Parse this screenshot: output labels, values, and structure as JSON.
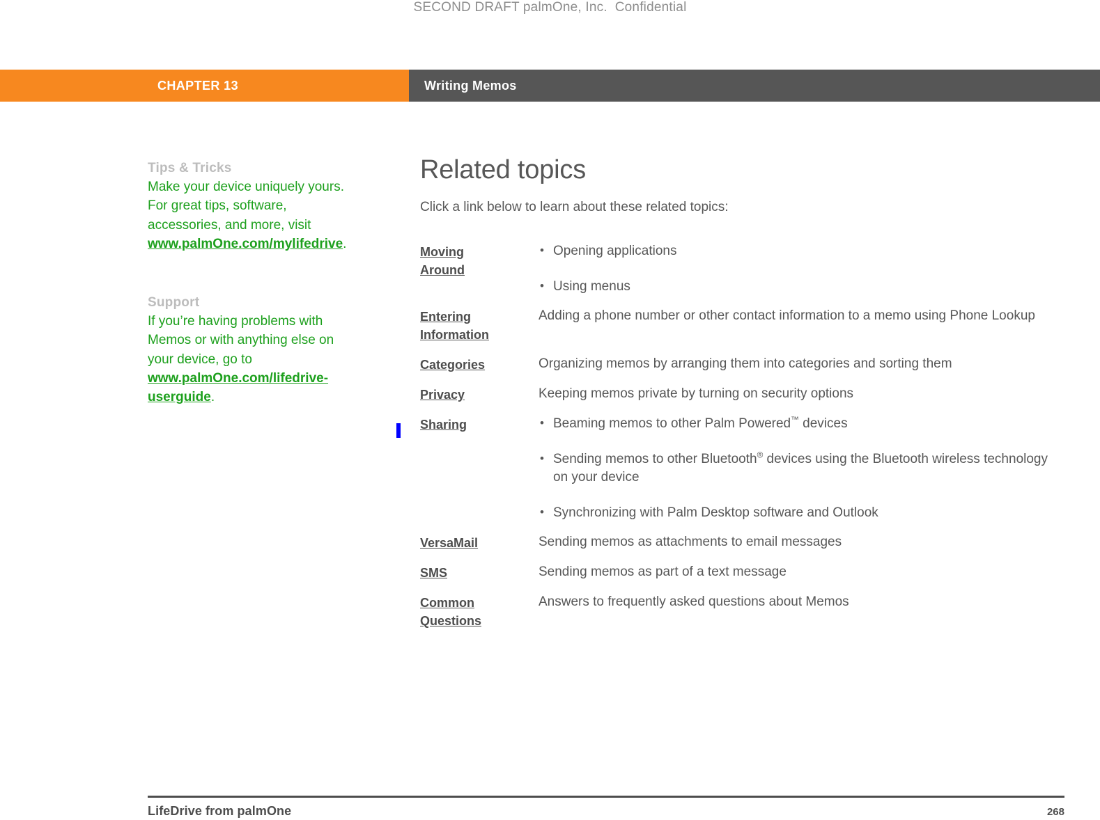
{
  "draft_header": "SECOND DRAFT palmOne, Inc.  Confidential",
  "banner": {
    "chapter": "CHAPTER 13",
    "title": "Writing Memos",
    "chapter_bg": "#f7881f",
    "title_bg": "#565656"
  },
  "sidebar": {
    "accent_color": "#1da01d",
    "heading_color": "#bcbcbc",
    "blocks": [
      {
        "heading": "Tips & Tricks",
        "body_before": "Make your device uniquely yours. For great tips, software, accessories, and more, visit ",
        "link": "www.palmOne.com/mylifedrive",
        "body_after": "."
      },
      {
        "heading": "Support",
        "body_before": "If you’re having problems with Memos or with anything else on your device, go to ",
        "link": "www.palmOne.com/lifedrive-userguide",
        "body_after": "."
      }
    ]
  },
  "main": {
    "title": "Related topics",
    "intro": "Click a link below to learn about these related topics:"
  },
  "topics": [
    {
      "label": "Moving Around",
      "label_lines": [
        "Moving ",
        "Around"
      ],
      "bullets": [
        "Opening applications",
        "Using menus"
      ]
    },
    {
      "label": "Entering Information",
      "label_lines": [
        "Entering ",
        "Information"
      ],
      "text": "Adding a phone number or other contact information to a memo using Phone Lookup"
    },
    {
      "label": "Categories",
      "label_lines": [
        "Categories"
      ],
      "text": "Organizing memos by arranging them into categories and sorting them"
    },
    {
      "label": "Privacy",
      "label_lines": [
        "Privacy"
      ],
      "text": "Keeping memos private by turning on security options"
    },
    {
      "label": "Sharing",
      "label_lines": [
        "Sharing"
      ],
      "bullets_html": [
        "Beaming memos to other Palm Powered<sup>™</sup> devices",
        "Sending memos to other Bluetooth<sup>®</sup> devices using the Bluetooth wireless technology on your device",
        "Synchronizing with Palm Desktop software and Outlook"
      ]
    },
    {
      "label": "VersaMail",
      "label_lines": [
        "VersaMail"
      ],
      "text": "Sending memos as attachments to email messages"
    },
    {
      "label": "SMS",
      "label_lines": [
        "SMS"
      ],
      "text": "Sending memos as part of a text message"
    },
    {
      "label": "Common Questions",
      "label_lines": [
        "Common ",
        "Questions"
      ],
      "text": "Answers to frequently asked questions about Memos"
    }
  ],
  "change_bar": {
    "color": "#0000ff"
  },
  "footer": {
    "left": "LifeDrive from palmOne",
    "page_number": "268"
  }
}
